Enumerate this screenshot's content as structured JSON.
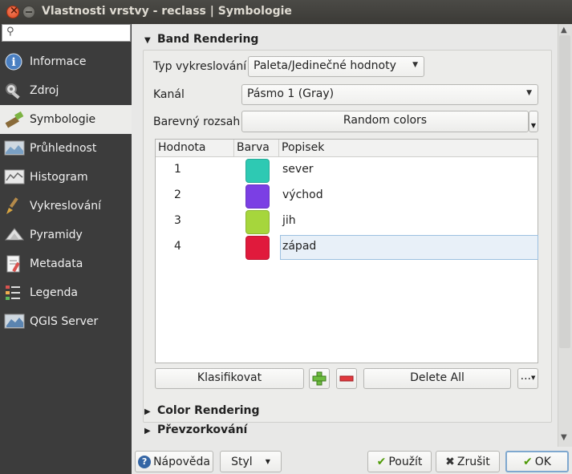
{
  "window": {
    "title": "Vlastnosti vrstvy - reclass | Symbologie"
  },
  "sidebar": {
    "search_placeholder": "",
    "items": [
      {
        "label": "Informace",
        "icon": "info-icon"
      },
      {
        "label": "Zdroj",
        "icon": "source-icon"
      },
      {
        "label": "Symbologie",
        "icon": "brush-icon",
        "active": true
      },
      {
        "label": "Průhlednost",
        "icon": "transparency-icon"
      },
      {
        "label": "Histogram",
        "icon": "histogram-icon"
      },
      {
        "label": "Vykreslování",
        "icon": "rendering-icon"
      },
      {
        "label": "Pyramidy",
        "icon": "pyramid-icon"
      },
      {
        "label": "Metadata",
        "icon": "metadata-icon"
      },
      {
        "label": "Legenda",
        "icon": "legend-icon"
      },
      {
        "label": "QGIS Server",
        "icon": "server-icon"
      }
    ]
  },
  "band_rendering": {
    "header": "Band Rendering",
    "type_label": "Typ vykreslování",
    "type_value": "Paleta/Jedinečné hodnoty",
    "channel_label": "Kanál",
    "channel_value": "Pásmo 1 (Gray)",
    "ramp_label": "Barevný rozsah",
    "ramp_value": "Random colors",
    "table": {
      "headers": [
        "Hodnota",
        "Barva",
        "Popisek"
      ],
      "rows": [
        {
          "value": "1",
          "color": "#2ec9b3",
          "label": "sever"
        },
        {
          "value": "2",
          "color": "#7b3fe4",
          "label": "východ"
        },
        {
          "value": "3",
          "color": "#a6d63c",
          "label": "jih"
        },
        {
          "value": "4",
          "color": "#e01a3c",
          "label": "západ"
        }
      ]
    },
    "classify_label": "Klasifikovat",
    "delete_all_label": "Delete All",
    "more_label": "..."
  },
  "sections": {
    "color_rendering": "Color Rendering",
    "resampling": "Převzorkování"
  },
  "footer": {
    "help": "Nápověda",
    "style": "Styl",
    "apply": "Použít",
    "cancel": "Zrušit",
    "ok": "OK"
  }
}
